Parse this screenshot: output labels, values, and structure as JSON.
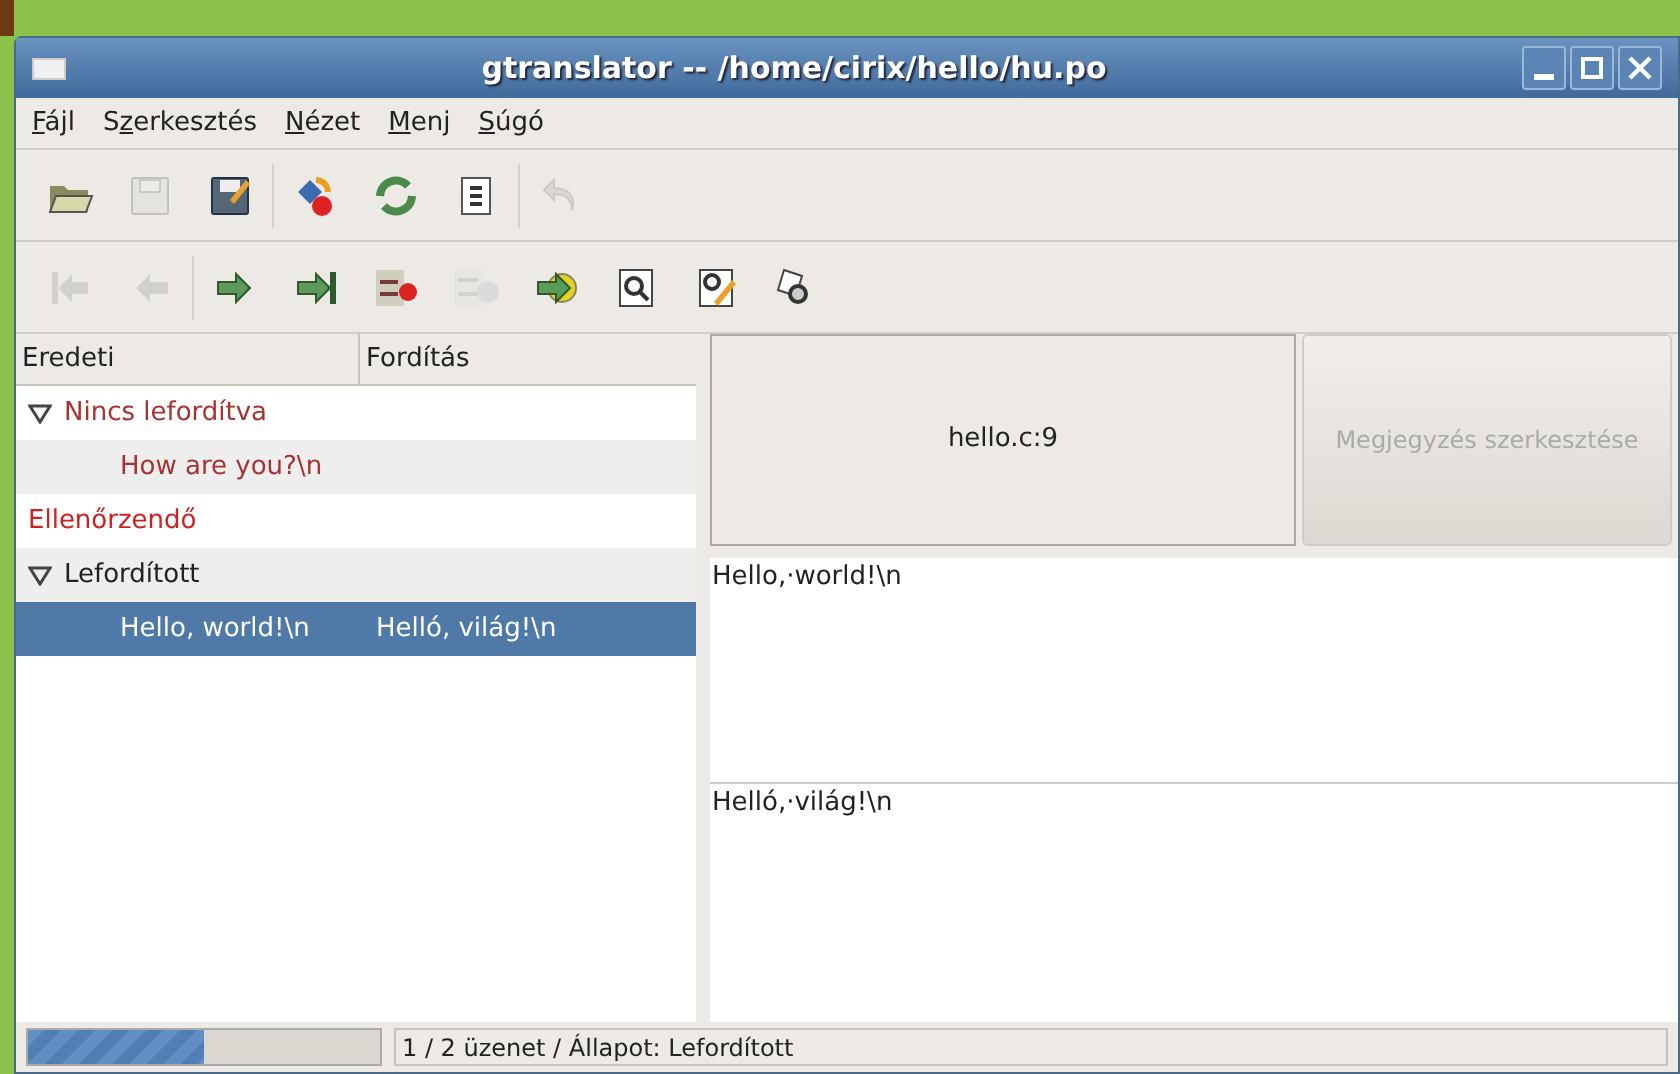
{
  "window": {
    "title": "gtranslator -- /home/cirix/hello/hu.po"
  },
  "menu": [
    {
      "key": "F",
      "after": "ájl"
    },
    {
      "before": "S",
      "key": "z",
      "after": "erkesztés"
    },
    {
      "key": "N",
      "after": "ézet"
    },
    {
      "key": "M",
      "after": "enj"
    },
    {
      "key": "S",
      "after": "úgó"
    }
  ],
  "toolbars": [
    [
      [
        {
          "kind": "open",
          "disabled": false
        },
        {
          "kind": "save",
          "disabled": true
        },
        {
          "kind": "edit",
          "disabled": false
        }
      ],
      [
        {
          "kind": "compile",
          "disabled": false
        },
        {
          "kind": "refresh",
          "disabled": false
        },
        {
          "kind": "header",
          "disabled": false
        }
      ],
      [
        {
          "kind": "undo",
          "disabled": true
        }
      ]
    ],
    [
      [
        {
          "kind": "first",
          "disabled": true
        },
        {
          "kind": "back",
          "disabled": true
        }
      ],
      [
        {
          "kind": "next",
          "disabled": false
        },
        {
          "kind": "last",
          "disabled": false
        },
        {
          "kind": "fuzzy",
          "disabled": false
        },
        {
          "kind": "untranslated",
          "disabled": true
        },
        {
          "kind": "goto",
          "disabled": false
        },
        {
          "kind": "find",
          "disabled": false
        },
        {
          "kind": "replace",
          "disabled": false
        },
        {
          "kind": "query",
          "disabled": false
        }
      ]
    ]
  ],
  "message_table": {
    "columns": [
      "Eredeti",
      "Fordítás"
    ],
    "groups": [
      {
        "label": "Nincs lefordítva",
        "color": "#a83232",
        "expanded": true,
        "rows": [
          {
            "original": "How are you?\\n",
            "selected": false
          }
        ]
      },
      {
        "label": "Ellenőrzendő",
        "color": "#cc2222"
      },
      {
        "label": "Lefordított",
        "color": "#222222",
        "expanded": true,
        "rows": [
          {
            "original": "Hello, world!\\n",
            "translation": "Helló, világ!\\n",
            "selected": true
          }
        ]
      }
    ]
  },
  "reference": "hello.c:9",
  "comment_button": {
    "label": "Megjegyzés szerkesztése",
    "disabled": true
  },
  "original_text": "Hello,·world!\\n",
  "translation_text": "Helló,·világ!\\n",
  "status_bar": {
    "level": 0.5,
    "text": "1 / 2 üzenet / Állapot: Lefordított"
  }
}
